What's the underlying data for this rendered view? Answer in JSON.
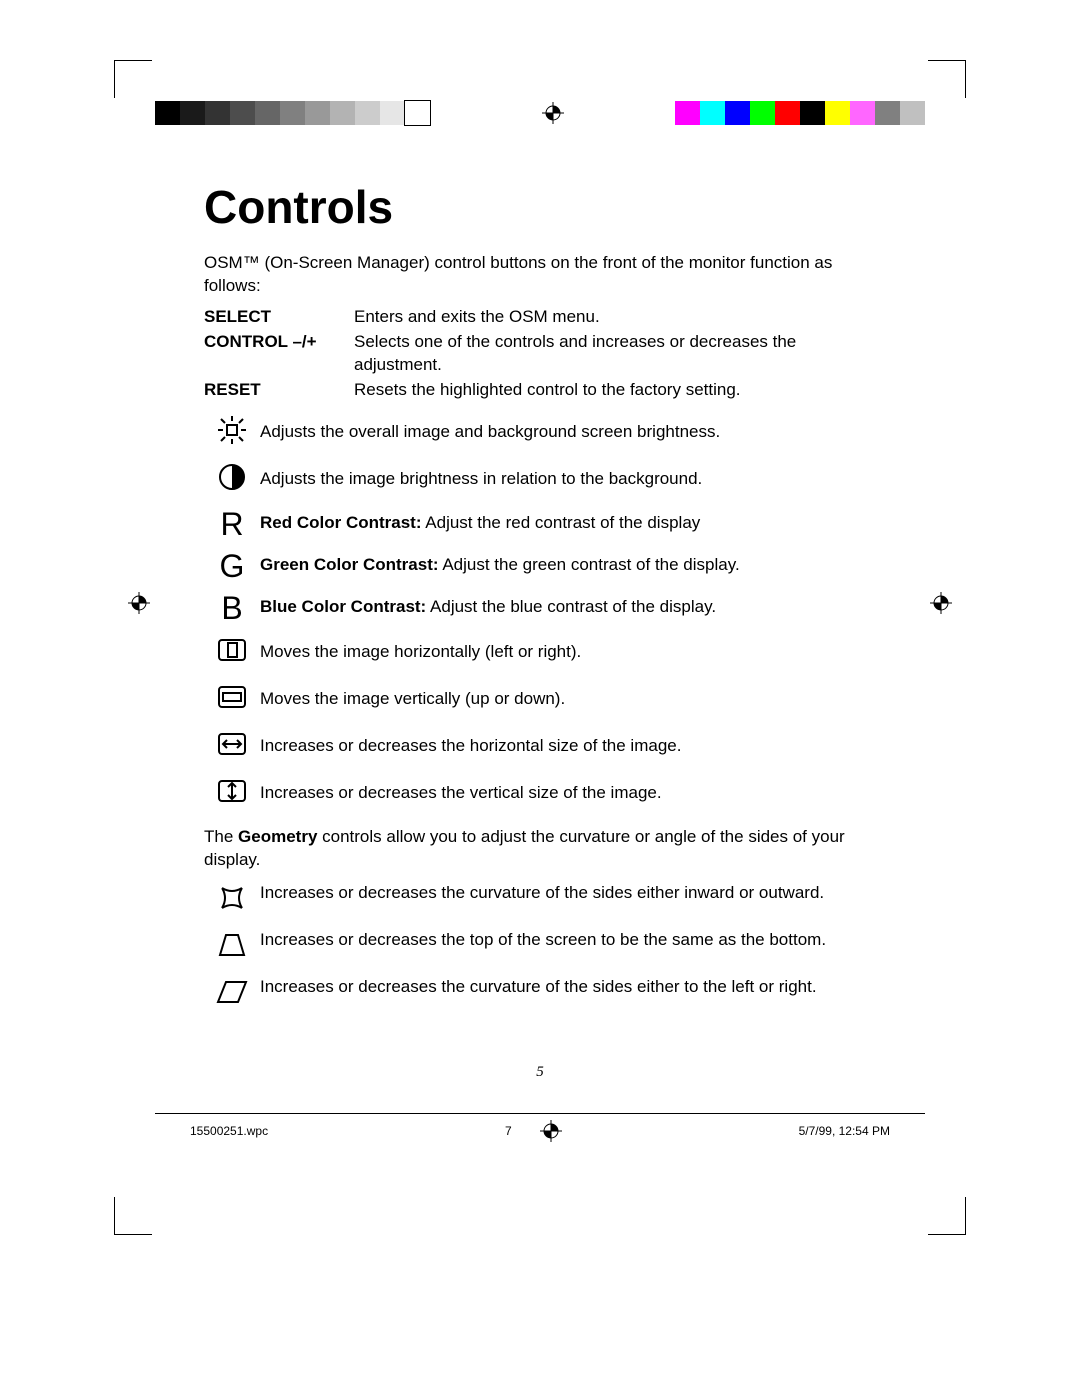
{
  "title": "Controls",
  "intro": "OSM™ (On-Screen Manager) control buttons on the front of the monitor function as follows:",
  "definitions": [
    {
      "term": "SELECT",
      "desc": "Enters and exits the OSM menu."
    },
    {
      "term": "CONTROL –/+",
      "desc": "Selects one of the controls and increases or decreases the adjustment."
    },
    {
      "term": "RESET",
      "desc": "Resets the highlighted control to the factory setting."
    }
  ],
  "rows": [
    {
      "icon": "brightness-icon",
      "letter": "",
      "bold": "",
      "text": "Adjusts the overall image and background screen brightness."
    },
    {
      "icon": "contrast-icon",
      "letter": "",
      "bold": "",
      "text": "Adjusts the image brightness in relation to the background."
    },
    {
      "icon": "",
      "letter": "R",
      "bold": "Red Color Contrast:",
      "text": " Adjust the red contrast of the display"
    },
    {
      "icon": "",
      "letter": "G",
      "bold": "Green Color Contrast:",
      "text": " Adjust the green contrast of the display."
    },
    {
      "icon": "",
      "letter": "B",
      "bold": "Blue Color Contrast:",
      "text": " Adjust the blue contrast of the display."
    },
    {
      "icon": "hpos-icon",
      "letter": "",
      "bold": "",
      "text": "Moves the image horizontally (left or right)."
    },
    {
      "icon": "vpos-icon",
      "letter": "",
      "bold": "",
      "text": "Moves the image vertically (up or down)."
    },
    {
      "icon": "hsize-icon",
      "letter": "",
      "bold": "",
      "text": "Increases or decreases the horizontal size of the image."
    },
    {
      "icon": "vsize-icon",
      "letter": "",
      "bold": "",
      "text": "Increases or decreases the vertical size of the image."
    }
  ],
  "geometry_intro_before": "The ",
  "geometry_intro_bold": "Geometry",
  "geometry_intro_after": " controls allow you to adjust the curvature or angle of the sides of your display.",
  "geometry_rows": [
    {
      "icon": "pincushion-icon",
      "text": "Increases or decreases the curvature of the sides either inward or outward."
    },
    {
      "icon": "trapezoid-icon",
      "text": "Increases or decreases the top of the screen to be the same as the bottom."
    },
    {
      "icon": "parallelogram-icon",
      "text": "Increases or decreases the curvature of the sides either to the left or right."
    }
  ],
  "page_number": "5",
  "footer": {
    "file": "15500251.wpc",
    "sheet": "7",
    "timestamp": "5/7/99, 12:54 PM"
  },
  "colorbar": {
    "grays": [
      "#000000",
      "#1a1a1a",
      "#333333",
      "#4d4d4d",
      "#666666",
      "#808080",
      "#999999",
      "#b3b3b3",
      "#cccccc",
      "#e6e6e6",
      "#ffffff"
    ],
    "colors": [
      "#ff00ff",
      "#00ffff",
      "#0000ff",
      "#00ff00",
      "#ff0000",
      "#000000",
      "#ffff00",
      "#ff66ff",
      "#808080",
      "#c0c0c0"
    ]
  }
}
